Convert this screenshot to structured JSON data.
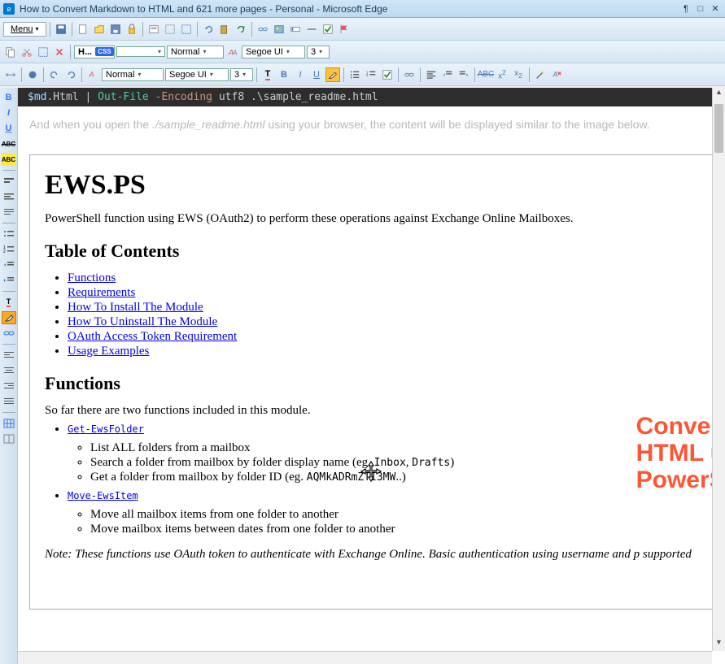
{
  "window": {
    "title": "How to Convert Markdown to HTML and 621 more pages - Personal - Microsoft Edge"
  },
  "menu": {
    "label": "Menu"
  },
  "toolbar2": {
    "heading_short": "H...",
    "css": "CSS",
    "style_normal": "Normal",
    "font": "Segoe UI",
    "size": "3"
  },
  "toolbar3": {
    "style": "Normal",
    "font": "Segoe UI",
    "size": "3"
  },
  "code_line": {
    "var": "$md",
    "prop": ".Html",
    "pipe": " | ",
    "cmd": "Out-File",
    "flag": " -Encoding",
    "enc": " utf8",
    "path": " .\\sample_readme.html"
  },
  "intro": {
    "pre": "And when you open the ",
    "ital": "./sample_readme.html",
    "post": " using your browser, the content will be displayed similar to the image below."
  },
  "doc": {
    "h1": "EWS.PS",
    "desc": "PowerShell function using EWS (OAuth2) to perform these operations against Exchange Online Mailboxes.",
    "toc_title": "Table of Contents",
    "toc": [
      "Functions",
      "Requirements",
      "How To Install The Module",
      "How To Uninstall The Module",
      "OAuth Access Token Requirement",
      "Usage Examples"
    ],
    "functions_title": "Functions",
    "functions_intro": "So far there are two functions included in this module.",
    "fn1": "Get-EwsFolder",
    "fn1_items": {
      "a": "List ALL folders from a mailbox",
      "b_pre": "Search a folder from mailbox by folder display name (eg. ",
      "b_code1": "Inbox",
      "b_mid": ", ",
      "b_code2": "Drafts",
      "b_post": ")",
      "c_pre": "Get a folder from mailbox by folder ID (eg. ",
      "c_code": "AQMkADRmZTI3MW",
      "c_post": "..)"
    },
    "fn2": "Move-EwsItem",
    "fn2_items": [
      "Move all mailbox items from one folder to another",
      "Move mailbox items between dates from one folder to another"
    ],
    "note": "Note: These functions use OAuth token to authenticate with Exchange Online. Basic authentication using username and p supported"
  },
  "watermark": {
    "l1": "Convert",
    "l2": "HTML u",
    "l3": "PowerS"
  }
}
